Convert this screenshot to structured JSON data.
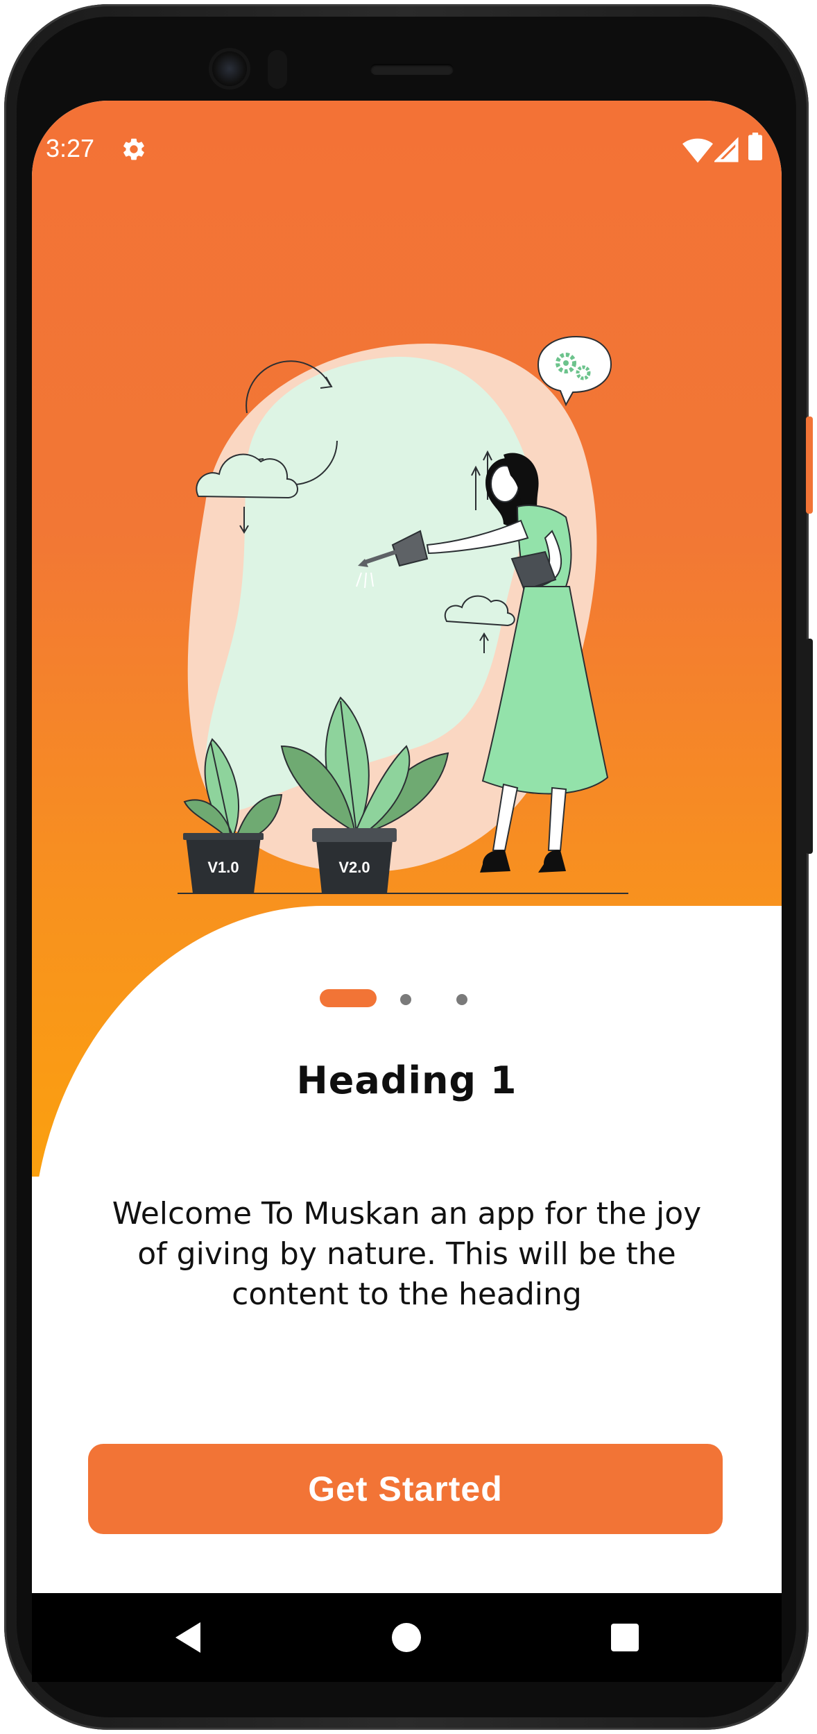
{
  "status_bar": {
    "time": "3:27",
    "icons": [
      "settings-gear-icon",
      "wifi-icon",
      "cell-signal-icon",
      "battery-icon"
    ]
  },
  "onboarding": {
    "illustration": {
      "pot_labels": [
        "V1.0",
        "V2.0"
      ]
    },
    "pager": {
      "page_count": 3,
      "active_index": 0
    },
    "heading": "Heading 1",
    "body": "Welcome To Muskan an app for the joy of giving by nature. This will be the content to the heading",
    "cta_label": "Get Started"
  },
  "nav_bar": {
    "buttons": [
      "back-icon",
      "home-icon",
      "recents-icon"
    ]
  },
  "colors": {
    "accent": "#F27436",
    "gradient_top": "#F37236",
    "gradient_bottom": "#FBA00F",
    "dot_inactive": "#7A7A7A",
    "plant_green": "#6FAA72",
    "dress_green": "#93E2AA",
    "blob_mint": "#DDF4E4",
    "blob_peach": "#FAD7C2",
    "pot_dark": "#2B2F33",
    "side_button": "#F27436"
  }
}
